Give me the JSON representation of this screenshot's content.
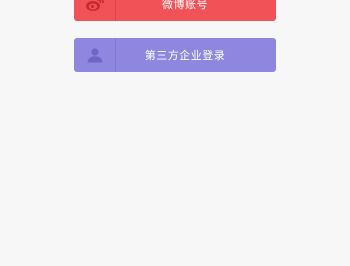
{
  "buttons": {
    "weibo": {
      "label": "微博账号",
      "icon": "weibo-icon",
      "color": "#f05258"
    },
    "enterprise": {
      "label": "第三方企业登录",
      "icon": "user-icon",
      "color": "#8f86df"
    }
  },
  "background_color": "#f7f7f7"
}
